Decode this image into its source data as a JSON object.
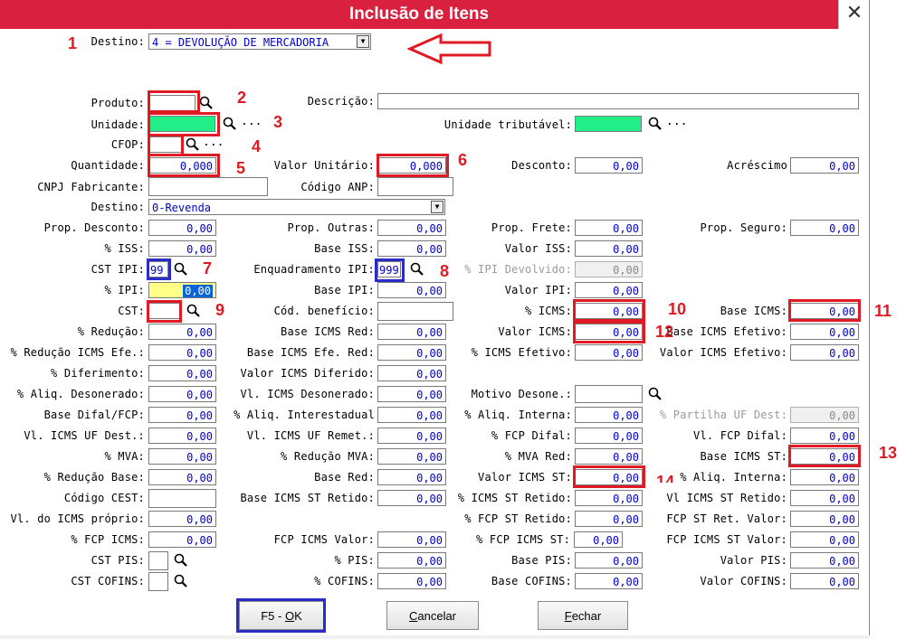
{
  "window": {
    "title": "Inclusão de Itens",
    "close_glyph": "✕"
  },
  "icons": {
    "search": "magnifier-icon",
    "close": "close-icon",
    "dropdown": "chevron-down-icon"
  },
  "colors": {
    "titlebar": "#d9203f",
    "annotation_red": "#e01a24",
    "annotation_blue": "#2b2bc8",
    "value_text": "#0000cc",
    "green_field": "#22ee88",
    "yellow_field": "#ffff88"
  },
  "destino_top": {
    "label": "Destino:",
    "value": "4 = DEVOLUÇÃO DE MERCADORIA"
  },
  "produto": {
    "label": "Produto:",
    "value": ""
  },
  "descricao": {
    "label": "Descrição:",
    "value": ""
  },
  "unidade": {
    "label": "Unidade:",
    "value": "",
    "dots": "..."
  },
  "unidade_trib": {
    "label": "Unidade tributável:",
    "value": "",
    "dots": "..."
  },
  "cfop": {
    "label": "CFOP:",
    "value": "",
    "dots": "..."
  },
  "quantidade": {
    "label": "Quantidade:",
    "value": "0,000"
  },
  "valor_unit": {
    "label": "Valor Unitário:",
    "value": "0,000"
  },
  "desconto": {
    "label": "Desconto:",
    "value": "0,00"
  },
  "acrescimo": {
    "label": "Acréscimo",
    "value": "0,00"
  },
  "cnpj_fab": {
    "label": "CNPJ Fabricante:",
    "value": ""
  },
  "cod_anp": {
    "label": "Código ANP:",
    "value": ""
  },
  "destino2": {
    "label": "Destino:",
    "value": "0-Revenda"
  },
  "prop_desc": {
    "label": "Prop. Desconto:",
    "value": "0,00"
  },
  "prop_outras": {
    "label": "Prop. Outras:",
    "value": "0,00"
  },
  "prop_frete": {
    "label": "Prop. Frete:",
    "value": "0,00"
  },
  "prop_seguro": {
    "label": "Prop. Seguro:",
    "value": "0,00"
  },
  "iss_pct": {
    "label": "% ISS:",
    "value": "0,00"
  },
  "base_iss": {
    "label": "Base ISS:",
    "value": "0,00"
  },
  "valor_iss": {
    "label": "Valor ISS:",
    "value": "0,00"
  },
  "cst_ipi": {
    "label": "CST IPI:",
    "value": "99"
  },
  "enq_ipi": {
    "label": "Enquadramento IPI:",
    "value": "999"
  },
  "ipi_dev": {
    "label": "% IPI Devolvido:",
    "value": "0,00"
  },
  "ipi_pct": {
    "label": "% IPI:",
    "value": "0,00"
  },
  "base_ipi": {
    "label": "Base IPI:",
    "value": "0,00"
  },
  "valor_ipi": {
    "label": "Valor IPI:",
    "value": "0,00"
  },
  "cst": {
    "label": "CST:",
    "value": ""
  },
  "cod_benef": {
    "label": "Cód. benefício:",
    "value": ""
  },
  "icms_pct": {
    "label": "% ICMS:",
    "value": "0,00"
  },
  "base_icms": {
    "label": "Base ICMS:",
    "value": "0,00"
  },
  "reducao": {
    "label": "% Redução:",
    "value": "0,00"
  },
  "base_icms_red": {
    "label": "Base ICMS Red:",
    "value": "0,00"
  },
  "valor_icms": {
    "label": "Valor ICMS:",
    "value": "0,00"
  },
  "base_icms_efetivo": {
    "label": "Base ICMS Efetivo:",
    "value": "0,00"
  },
  "red_icms_efe": {
    "label": "% Redução ICMS Efe.:",
    "value": "0,00"
  },
  "base_icms_efe_red": {
    "label": "Base ICMS Efe. Red:",
    "value": "0,00"
  },
  "icms_efetivo_pct": {
    "label": "% ICMS Efetivo:",
    "value": "0,00"
  },
  "valor_icms_efetivo": {
    "label": "Valor ICMS Efetivo:",
    "value": "0,00"
  },
  "diferimento": {
    "label": "% Diferimento:",
    "value": "0,00"
  },
  "valor_icms_dif": {
    "label": "Valor ICMS Diferido:",
    "value": "0,00"
  },
  "aliq_desonerado": {
    "label": "% Aliq. Desonerado:",
    "value": "0,00"
  },
  "vl_icms_deson": {
    "label": "Vl. ICMS Desonerado:",
    "value": "0,00"
  },
  "motivo_deson": {
    "label": "Motivo Desone.:",
    "value": ""
  },
  "base_difal": {
    "label": "Base Difal/FCP:",
    "value": "0,00"
  },
  "aliq_interestadual": {
    "label": "% Aliq. Interestadual",
    "value": "0,00"
  },
  "aliq_interna": {
    "label": "% Aliq. Interna:",
    "value": "0,00"
  },
  "partilha_uf": {
    "label": "% Partilha UF Dest:",
    "value": "0,00"
  },
  "vl_icms_uf_dest": {
    "label": "Vl. ICMS UF Dest.:",
    "value": "0,00"
  },
  "vl_icms_uf_remet": {
    "label": "Vl. ICMS UF Remet.:",
    "value": "0,00"
  },
  "fcp_difal_pct": {
    "label": "% FCP Difal:",
    "value": "0,00"
  },
  "vl_fcp_difal": {
    "label": "Vl. FCP Difal:",
    "value": "0,00"
  },
  "mva": {
    "label": "% MVA:",
    "value": "0,00"
  },
  "red_mva": {
    "label": "% Redução MVA:",
    "value": "0,00"
  },
  "mva_red": {
    "label": "% MVA Red:",
    "value": "0,00"
  },
  "base_icms_st": {
    "label": "Base ICMS ST:",
    "value": "0,00"
  },
  "red_base": {
    "label": "% Redução Base:",
    "value": "0,00"
  },
  "base_red": {
    "label": "Base Red:",
    "value": "0,00"
  },
  "valor_icms_st": {
    "label": "Valor ICMS ST:",
    "value": "0,00"
  },
  "aliq_interna2": {
    "label": "% Aliq. Interna:",
    "value": "0,00"
  },
  "codigo_cest": {
    "label": "Código CEST:",
    "value": ""
  },
  "base_icms_st_ret": {
    "label": "Base ICMS ST Retido:",
    "value": "0,00"
  },
  "icms_st_ret_pct": {
    "label": "% ICMS ST Retido:",
    "value": "0,00"
  },
  "vl_icms_st_ret": {
    "label": "Vl ICMS ST Retido:",
    "value": "0,00"
  },
  "vl_icms_proprio": {
    "label": "Vl. do ICMS próprio:",
    "value": "0,00"
  },
  "fcp_st_ret_pct": {
    "label": "% FCP ST Retido:",
    "value": "0,00"
  },
  "fcp_st_ret_valor": {
    "label": "FCP ST Ret. Valor:",
    "value": "0,00"
  },
  "fcp_icms_pct": {
    "label": "% FCP ICMS:",
    "value": "0,00"
  },
  "fcp_icms_valor": {
    "label": "FCP ICMS Valor:",
    "value": "0,00"
  },
  "fcp_icms_st_pct": {
    "label": "% FCP ICMS ST:",
    "value": "0,00"
  },
  "fcp_icms_st_valor": {
    "label": "FCP ICMS ST Valor:",
    "value": "0,00"
  },
  "cst_pis": {
    "label": "CST PIS:",
    "value": ""
  },
  "pis_pct": {
    "label": "% PIS:",
    "value": "0,00"
  },
  "base_pis": {
    "label": "Base PIS:",
    "value": "0,00"
  },
  "valor_pis": {
    "label": "Valor PIS:",
    "value": "0,00"
  },
  "cst_cofins": {
    "label": "CST COFINS:",
    "value": ""
  },
  "cofins_pct": {
    "label": "% COFINS:",
    "value": "0,00"
  },
  "base_cofins": {
    "label": "Base COFINS:",
    "value": "0,00"
  },
  "valor_cofins": {
    "label": "Valor COFINS:",
    "value": "0,00"
  },
  "buttons": {
    "ok_pre": "F5 - ",
    "ok_hk": "O",
    "ok_post": "K",
    "cancel_hk": "C",
    "cancel_post": "ancelar",
    "close_hk": "F",
    "close_post": "echar"
  },
  "annotations": [
    "1",
    "2",
    "3",
    "4",
    "5",
    "6",
    "7",
    "8",
    "9",
    "10",
    "11",
    "12",
    "13",
    "14"
  ]
}
